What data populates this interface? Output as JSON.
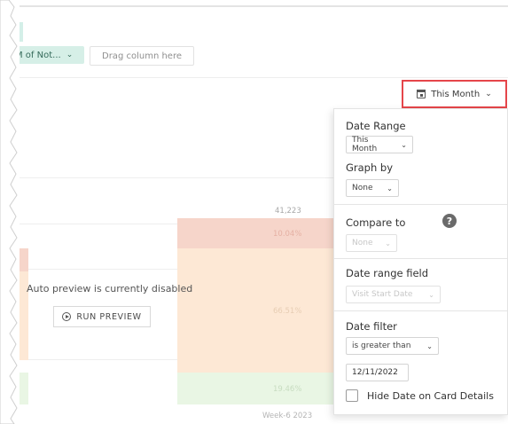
{
  "toolbar": {
    "column_chip": "M of Not...",
    "drag_placeholder": "Drag column here"
  },
  "period_button": {
    "label": "This Month"
  },
  "chart": {
    "values": [
      "41,223",
      "10.04%",
      "66.51%",
      "19.46%"
    ],
    "week_label": "Week-6 2023",
    "colors": {
      "red": "#f6d5ca",
      "orange": "#fde8d5",
      "green": "#e9f6e4"
    }
  },
  "preview": {
    "message": "Auto preview is currently disabled",
    "run_label": "RUN PREVIEW"
  },
  "panel": {
    "date_range_label": "Date Range",
    "date_range_value": "This Month",
    "graph_by_label": "Graph by",
    "graph_by_value": "None",
    "compare_label": "Compare to",
    "compare_value": "None",
    "date_field_label": "Date range field",
    "date_field_placeholder": "Visit Start Date",
    "date_filter_label": "Date filter",
    "date_filter_value": "is greater than",
    "date_value": "12/11/2022",
    "hide_date_label": "Hide Date on Card Details"
  },
  "accent_color": "#e5454a"
}
